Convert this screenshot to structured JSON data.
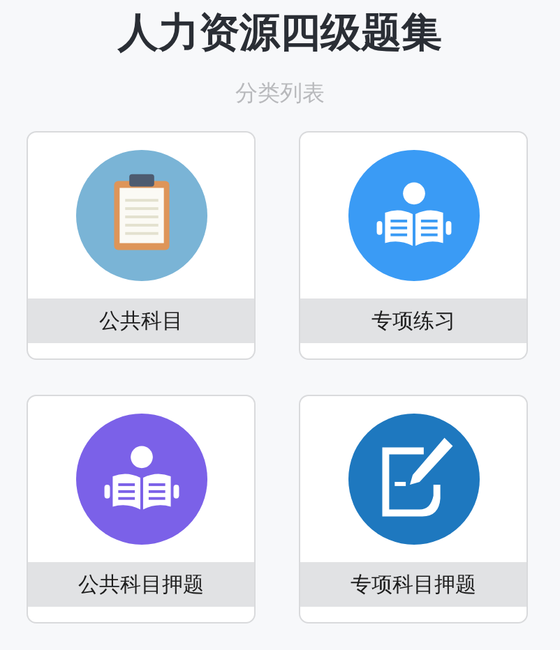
{
  "title": "人力资源四级题集",
  "subtitle": "分类列表",
  "categories": [
    {
      "label": "公共科目",
      "kind": "clipboard",
      "color": "#7ab4d6"
    },
    {
      "label": "专项练习",
      "kind": "reader",
      "color": "#3a9bf5"
    },
    {
      "label": "公共科目押题",
      "kind": "reader",
      "color": "#7b61e8"
    },
    {
      "label": "专项科目押题",
      "kind": "pen-note",
      "color": "#1e78bf"
    }
  ]
}
